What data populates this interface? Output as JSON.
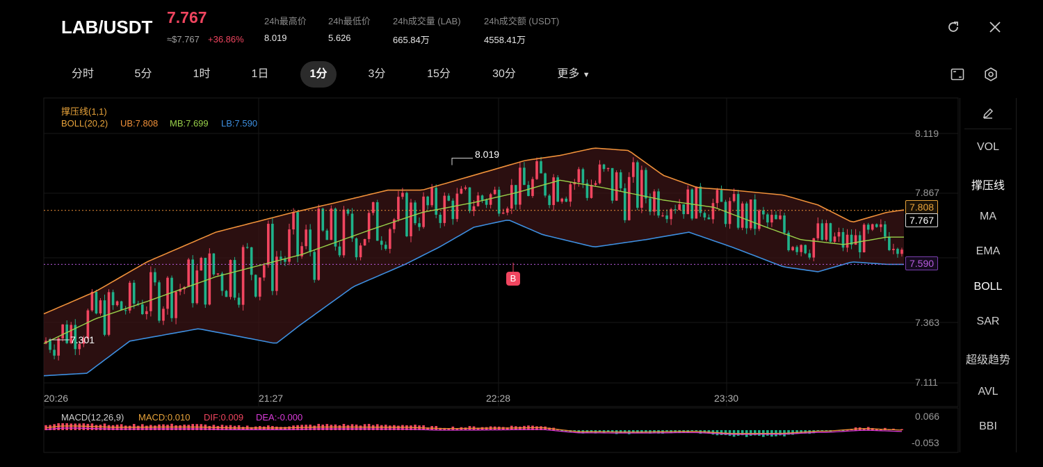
{
  "header": {
    "pair": "LAB/USDT",
    "price": "7.767",
    "approx": "≈$7.767",
    "change": "+36.86%",
    "stats": [
      {
        "label": "24h最高价",
        "value": "8.019"
      },
      {
        "label": "24h最低价",
        "value": "5.626"
      },
      {
        "label": "24h成交量 (LAB)",
        "value": "665.84万"
      },
      {
        "label": "24h成交额 (USDT)",
        "value": "4558.41万"
      }
    ],
    "icons": [
      "refresh-icon",
      "close-icon"
    ]
  },
  "timeframes": [
    "分时",
    "5分",
    "1时",
    "1日",
    "1分",
    "3分",
    "15分",
    "30分",
    "更多"
  ],
  "active_timeframe": "1分",
  "toolbar_icons": [
    "fullscreen-icon",
    "settings-icon"
  ],
  "indicators": [
    "VOL",
    "撑压线",
    "MA",
    "EMA",
    "BOLL",
    "SAR",
    "超级趋势",
    "AVL",
    "BBI"
  ],
  "legend": {
    "support": "撑压线(1,1)",
    "boll": "BOLL(20,2)",
    "ub": "UB:7.808",
    "mb": "MB:7.699",
    "lb": "LB:7.590",
    "macd_name": "MACD(12,26,9)",
    "macd": "MACD:0.010",
    "dif": "DIF:0.009",
    "dea": "DEA:-0.000"
  },
  "price_axis": [
    "8.119",
    "7.867",
    "7.363",
    "7.111"
  ],
  "macd_axis": [
    "0.066",
    "-0.053"
  ],
  "time_axis": [
    "20:26",
    "21:27",
    "22:28",
    "23:30"
  ],
  "annotations": {
    "high": "8.019",
    "low": "7.301",
    "buy_marker": "B",
    "ub_tag": "7.808",
    "last_tag": "7.767",
    "lb_tag": "7.590"
  },
  "colors": {
    "up": "#f0455f",
    "down": "#1fb28a",
    "ub": "#f0913a",
    "mb": "#9ad24a",
    "lb": "#3d8fe0",
    "dea": "#d93bd9",
    "dif": "#f0913a",
    "accent_orange": "#e8a33a"
  },
  "chart_data": {
    "type": "candlestick",
    "title": "",
    "xlabel": "",
    "ylabel": "",
    "ylim": [
      7.111,
      8.119
    ],
    "x": [
      "20:26",
      "21:27",
      "22:28",
      "23:30"
    ],
    "bands": {
      "ub_points": [
        [
          0,
          7.39
        ],
        [
          0.06,
          7.48
        ],
        [
          0.12,
          7.6
        ],
        [
          0.2,
          7.72
        ],
        [
          0.29,
          7.8
        ],
        [
          0.34,
          7.84
        ],
        [
          0.4,
          7.89
        ],
        [
          0.44,
          7.89
        ],
        [
          0.48,
          7.93
        ],
        [
          0.52,
          7.97
        ],
        [
          0.56,
          8.01
        ],
        [
          0.6,
          8.03
        ],
        [
          0.64,
          8.06
        ],
        [
          0.68,
          8.05
        ],
        [
          0.72,
          7.95
        ],
        [
          0.76,
          7.9
        ],
        [
          0.8,
          7.89
        ],
        [
          0.86,
          7.87
        ],
        [
          0.9,
          7.83
        ],
        [
          0.94,
          7.76
        ],
        [
          0.98,
          7.8
        ],
        [
          1.0,
          7.81
        ]
      ],
      "mb_points": [
        [
          0,
          7.27
        ],
        [
          0.06,
          7.37
        ],
        [
          0.12,
          7.44
        ],
        [
          0.2,
          7.54
        ],
        [
          0.3,
          7.63
        ],
        [
          0.38,
          7.73
        ],
        [
          0.44,
          7.8
        ],
        [
          0.5,
          7.84
        ],
        [
          0.55,
          7.88
        ],
        [
          0.6,
          7.93
        ],
        [
          0.65,
          7.9
        ],
        [
          0.72,
          7.85
        ],
        [
          0.78,
          7.82
        ],
        [
          0.84,
          7.74
        ],
        [
          0.88,
          7.69
        ],
        [
          0.93,
          7.67
        ],
        [
          0.98,
          7.7
        ],
        [
          1.0,
          7.7
        ]
      ],
      "lb_points": [
        [
          0,
          7.14
        ],
        [
          0.05,
          7.15
        ],
        [
          0.1,
          7.28
        ],
        [
          0.18,
          7.33
        ],
        [
          0.27,
          7.27
        ],
        [
          0.3,
          7.35
        ],
        [
          0.36,
          7.5
        ],
        [
          0.42,
          7.59
        ],
        [
          0.46,
          7.66
        ],
        [
          0.5,
          7.74
        ],
        [
          0.54,
          7.77
        ],
        [
          0.58,
          7.71
        ],
        [
          0.64,
          7.66
        ],
        [
          0.7,
          7.69
        ],
        [
          0.75,
          7.72
        ],
        [
          0.8,
          7.66
        ],
        [
          0.86,
          7.58
        ],
        [
          0.9,
          7.56
        ],
        [
          0.94,
          7.6
        ],
        [
          0.98,
          7.59
        ],
        [
          1.0,
          7.59
        ]
      ]
    },
    "series": [
      {
        "name": "UB",
        "value": 7.808
      },
      {
        "name": "MB",
        "value": 7.699
      },
      {
        "name": "LB",
        "value": 7.59
      }
    ],
    "high": 8.019,
    "low": 7.301,
    "last": 7.767
  }
}
